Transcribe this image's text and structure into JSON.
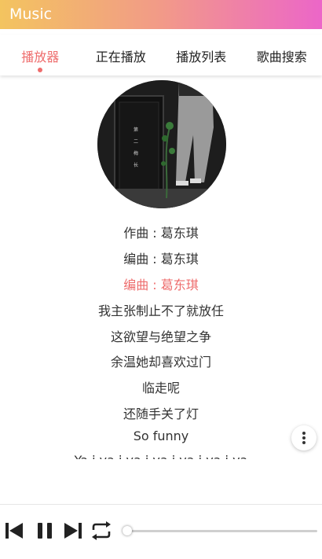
{
  "app": {
    "title": "Music"
  },
  "tabs": [
    {
      "label": "播放器",
      "active": true
    },
    {
      "label": "正在播放",
      "active": false
    },
    {
      "label": "播放列表",
      "active": false
    },
    {
      "label": "歌曲搜索",
      "active": false
    }
  ],
  "cover": {
    "vertical_text": [
      "第",
      "二",
      "梅",
      "长"
    ]
  },
  "lyrics": [
    {
      "text": "作曲 : 葛东琪",
      "current": false
    },
    {
      "text": "编曲 : 葛东琪",
      "current": false
    },
    {
      "text": "编曲 : 葛东琪",
      "current": true
    },
    {
      "text": "我主张制止不了就放任",
      "current": false
    },
    {
      "text": "这欲望与绝望之争",
      "current": false
    },
    {
      "text": "余温她却喜欢过门",
      "current": false
    },
    {
      "text": "临走呢",
      "current": false
    },
    {
      "text": "还随手关了灯",
      "current": false
    },
    {
      "text": "So funny",
      "current": false
    },
    {
      "text": "Ya i ya i ya i ya i ya i ya i ya",
      "current": false
    }
  ],
  "player": {
    "progress": 0.0
  },
  "colors": {
    "accent": "#ee6c6c",
    "gradient_start": "#f3c45f",
    "gradient_end": "#ec66c8"
  },
  "icons": {
    "prev": "skip-previous-icon",
    "pause": "pause-icon",
    "next": "skip-next-icon",
    "repeat": "repeat-icon",
    "more": "more-vertical-icon"
  }
}
